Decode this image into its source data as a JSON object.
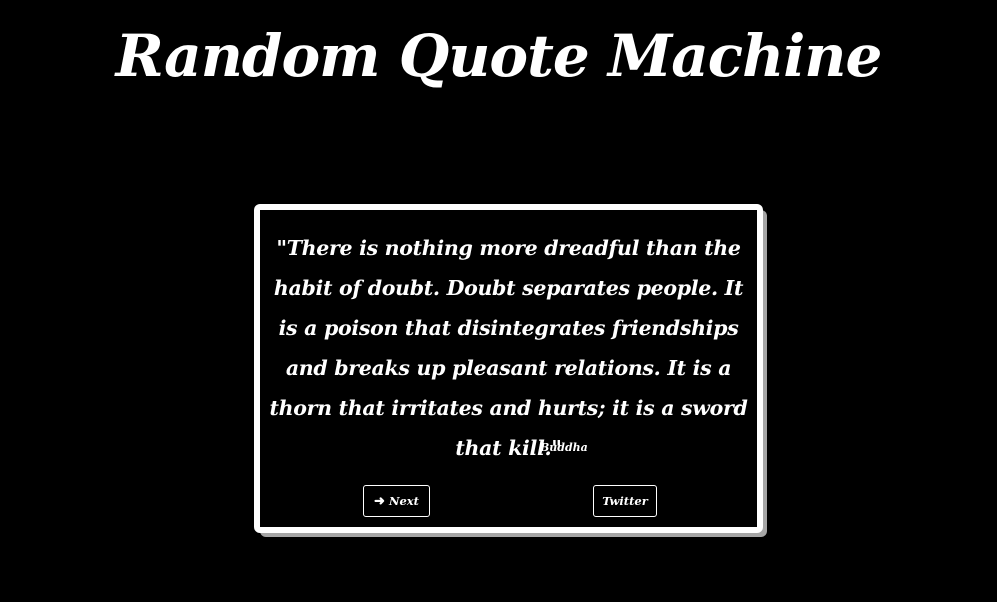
{
  "header": {
    "title": "Random Quote Machine"
  },
  "quote": {
    "text": "\"There is nothing more dreadful than the habit of doubt. Doubt separates people. It is a poison that disintegrates friendships and breaks up pleasant relations. It is a thorn that irritates and hurts; it is a sword that kill.\"",
    "author": "Buddha"
  },
  "buttons": {
    "next_label": "Next",
    "next_icon": "arrow-right-icon",
    "twitter_label": "Twitter"
  },
  "colors": {
    "background": "#000000",
    "text": "#ffffff",
    "card_border": "#ffffff",
    "card_shadow": "#a6a6a6"
  }
}
